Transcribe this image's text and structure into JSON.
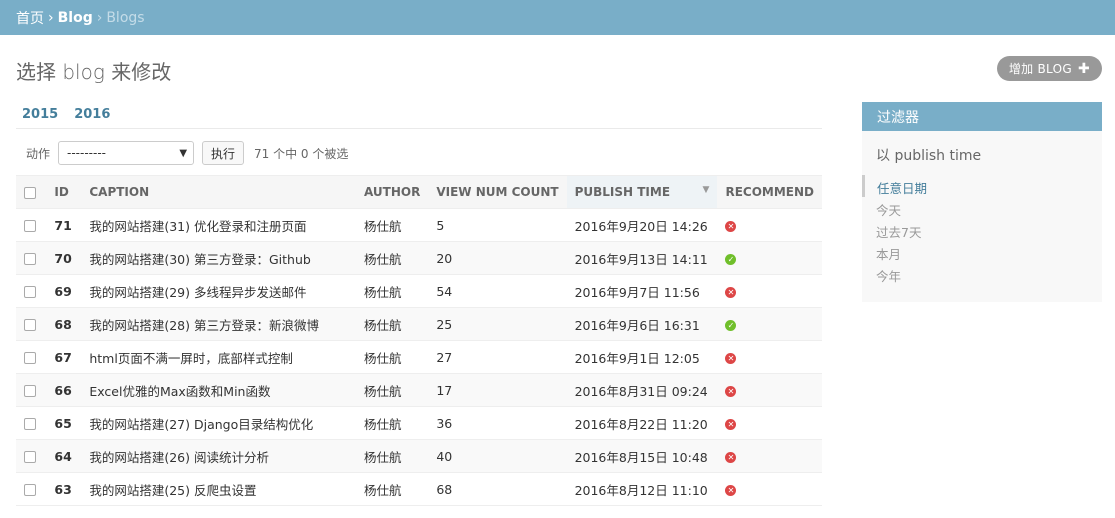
{
  "breadcrumbs": {
    "home": "首页",
    "app": "Blog",
    "current": "Blogs"
  },
  "page_title": "选择 blog 来修改",
  "add_button": "增加 BLOG",
  "date_hierarchy": [
    "2015",
    "2016"
  ],
  "actions": {
    "label": "动作",
    "selected": "---------",
    "go": "执行",
    "counter": "71 个中 0 个被选"
  },
  "table": {
    "headers": [
      "ID",
      "CAPTION",
      "AUTHOR",
      "VIEW NUM COUNT",
      "PUBLISH TIME",
      "RECOMMEND"
    ],
    "rows": [
      {
        "id": "71",
        "caption": "我的网站搭建(31) 优化登录和注册页面",
        "author": "杨仕航",
        "views": "5",
        "time": "2016年9月20日 14:26",
        "recommend": false
      },
      {
        "id": "70",
        "caption": "我的网站搭建(30) 第三方登录：Github",
        "author": "杨仕航",
        "views": "20",
        "time": "2016年9月13日 14:11",
        "recommend": true
      },
      {
        "id": "69",
        "caption": "我的网站搭建(29) 多线程异步发送邮件",
        "author": "杨仕航",
        "views": "54",
        "time": "2016年9月7日 11:56",
        "recommend": false
      },
      {
        "id": "68",
        "caption": "我的网站搭建(28) 第三方登录：新浪微博",
        "author": "杨仕航",
        "views": "25",
        "time": "2016年9月6日 16:31",
        "recommend": true
      },
      {
        "id": "67",
        "caption": "html页面不满一屏时，底部样式控制",
        "author": "杨仕航",
        "views": "27",
        "time": "2016年9月1日 12:05",
        "recommend": false
      },
      {
        "id": "66",
        "caption": "Excel优雅的Max函数和Min函数",
        "author": "杨仕航",
        "views": "17",
        "time": "2016年8月31日 09:24",
        "recommend": false
      },
      {
        "id": "65",
        "caption": "我的网站搭建(27) Django目录结构优化",
        "author": "杨仕航",
        "views": "36",
        "time": "2016年8月22日 11:20",
        "recommend": false
      },
      {
        "id": "64",
        "caption": "我的网站搭建(26) 阅读统计分析",
        "author": "杨仕航",
        "views": "40",
        "time": "2016年8月15日 10:48",
        "recommend": false
      },
      {
        "id": "63",
        "caption": "我的网站搭建(25) 反爬虫设置",
        "author": "杨仕航",
        "views": "68",
        "time": "2016年8月12日 11:10",
        "recommend": false
      }
    ]
  },
  "filter": {
    "title": "过滤器",
    "subtitle": "以 publish time",
    "options": [
      "任意日期",
      "今天",
      "过去7天",
      "本月",
      "今年"
    ],
    "selected_index": 0
  },
  "colors": {
    "header": "#79aec8",
    "link": "#447e9b",
    "no": "#dd4646",
    "yes": "#70bf2b"
  }
}
